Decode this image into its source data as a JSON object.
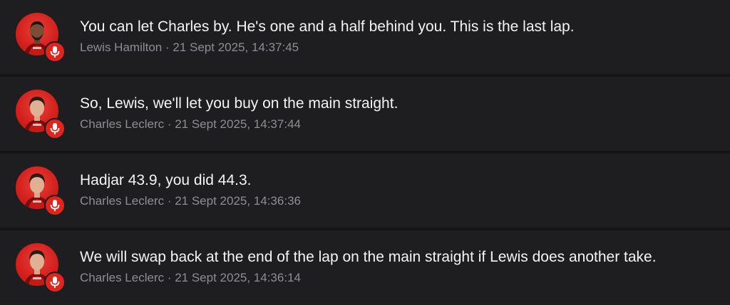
{
  "messages": [
    {
      "text": "You can let Charles by. He's one and a half behind you. This is the last lap.",
      "meta": "Lewis Hamilton · 21 Sept 2025, 14:37:45",
      "avatar": "lewis-hamilton-avatar",
      "badge_icon": "microphone-icon"
    },
    {
      "text": "So, Lewis, we'll let you buy on the main straight.",
      "meta": "Charles Leclerc · 21 Sept 2025, 14:37:44",
      "avatar": "charles-leclerc-avatar",
      "badge_icon": "microphone-icon"
    },
    {
      "text": "Hadjar 43.9, you did 44.3.",
      "meta": "Charles Leclerc · 21 Sept 2025, 14:36:36",
      "avatar": "charles-leclerc-avatar",
      "badge_icon": "microphone-icon"
    },
    {
      "text": "We will swap back at the end of the lap on the main straight if Lewis does another take.",
      "meta": "Charles Leclerc · 21 Sept 2025, 14:36:14",
      "avatar": "charles-leclerc-avatar",
      "badge_icon": "microphone-icon"
    }
  ],
  "colors": {
    "background": "#1c1c1e",
    "avatar_red": "#d21f1b",
    "badge_red": "#e0241e",
    "meta_gray": "#8e8e93",
    "text": "#f4f4f4"
  }
}
